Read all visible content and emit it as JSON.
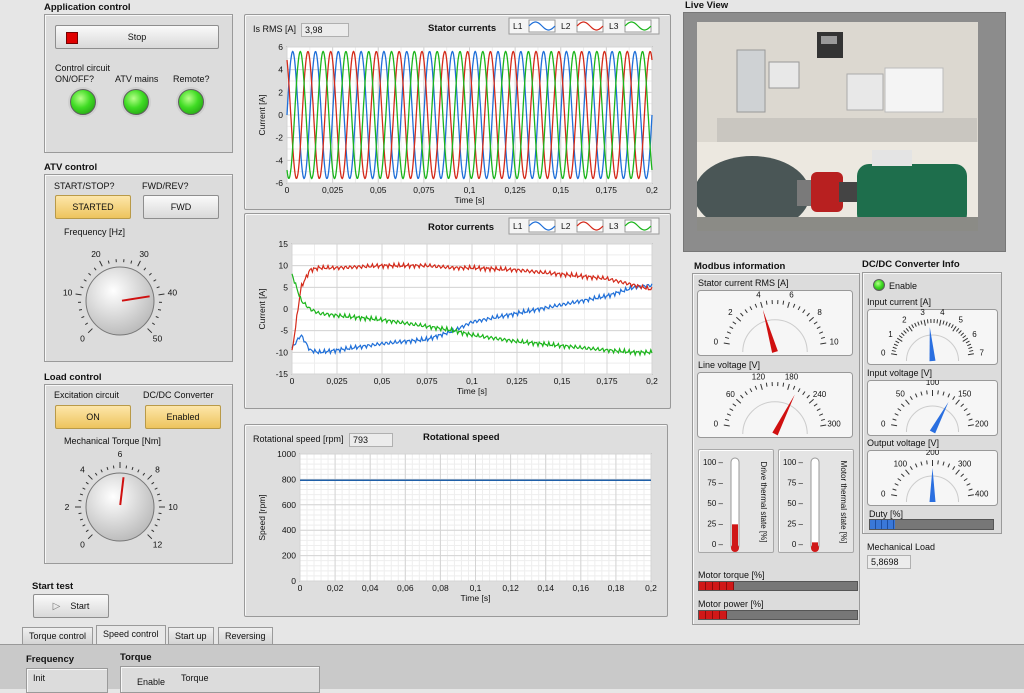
{
  "app": {
    "title": "Application control",
    "stop_label": "Stop",
    "control_circuit_label": "Control circuit\nON/OFF?",
    "atv_mains_label": "ATV mains",
    "remote_label": "Remote?"
  },
  "atv": {
    "title": "ATV control",
    "start_stop_label": "START/STOP?",
    "start_button": "STARTED",
    "fwd_rev_label": "FWD/REV?",
    "fwd_button": "FWD",
    "freq_label": "Frequency [Hz]",
    "freq_ticks": [
      "0",
      "10",
      "20",
      "30",
      "40",
      "50"
    ],
    "freq_value": 40
  },
  "load": {
    "title": "Load control",
    "excitation_label": "Excitation circuit",
    "excitation_button": "ON",
    "dcdc_label": "DC/DC Converter",
    "dcdc_button": "Enabled",
    "torque_label": "Mechanical Torque [Nm]",
    "torque_ticks": [
      "0",
      "2",
      "4",
      "6",
      "8",
      "10",
      "12"
    ],
    "torque_value": 6.3
  },
  "start_test": {
    "title": "Start test",
    "button": "Start"
  },
  "stator": {
    "title": "Stator currents",
    "rms_label": "Is RMS [A]",
    "rms_value": "3,98",
    "ylabel": "Current [A]",
    "xlabel": "Time [s]",
    "legend": [
      "L1",
      "L2",
      "L3"
    ],
    "yticks": [
      "6",
      "4",
      "2",
      "0",
      "-2",
      "-4",
      "-6"
    ],
    "xticks": [
      "0",
      "0,025",
      "0,05",
      "0,075",
      "0,1",
      "0,125",
      "0,15",
      "0,175",
      "0,2"
    ]
  },
  "rotor": {
    "title": "Rotor currents",
    "ylabel": "Current [A]",
    "xlabel": "Time [s]",
    "legend": [
      "L1",
      "L2",
      "L3"
    ],
    "yticks": [
      "15",
      "10",
      "5",
      "0",
      "-5",
      "-10",
      "-15"
    ],
    "xticks": [
      "0",
      "0,025",
      "0,05",
      "0,075",
      "0,1",
      "0,125",
      "0,15",
      "0,175",
      "0,2"
    ]
  },
  "speed": {
    "title": "Rotational speed",
    "value_label": "Rotational speed [rpm]",
    "value": "793",
    "ylabel": "Speed [rpm]",
    "xlabel": "Time [s]",
    "yticks": [
      "1000",
      "800",
      "600",
      "400",
      "200",
      "0"
    ],
    "xticks": [
      "0",
      "0,02",
      "0,04",
      "0,06",
      "0,08",
      "0,1",
      "0,12",
      "0,14",
      "0,16",
      "0,18",
      "0,2"
    ]
  },
  "chart_data": [
    {
      "type": "line",
      "title": "Stator currents",
      "xlabel": "Time [s]",
      "ylabel": "Current [A]",
      "xlim": [
        0,
        0.2
      ],
      "ylim": [
        -6,
        6
      ],
      "series": [
        {
          "name": "L1",
          "color": "#1f6fd8",
          "amplitude": 5.6,
          "frequency_hz": 80,
          "phase_deg": 0
        },
        {
          "name": "L2",
          "color": "#d42a1a",
          "amplitude": 5.6,
          "frequency_hz": 80,
          "phase_deg": 120
        },
        {
          "name": "L3",
          "color": "#1bb51b",
          "amplitude": 5.6,
          "frequency_hz": 80,
          "phase_deg": 240
        }
      ]
    },
    {
      "type": "line",
      "title": "Rotor currents",
      "xlabel": "Time [s]",
      "ylabel": "Current [A]",
      "xlim": [
        0,
        0.2
      ],
      "ylim": [
        -15,
        15
      ],
      "x": [
        0,
        0.005,
        0.01,
        0.015,
        0.025,
        0.05,
        0.075,
        0.09,
        0.1,
        0.125,
        0.15,
        0.175,
        0.19,
        0.2
      ],
      "series": [
        {
          "name": "L1",
          "color": "#1f6fd8",
          "values": [
            -9,
            -6,
            -9.5,
            -10,
            -9.5,
            -8,
            -7,
            -5,
            -3,
            -1,
            1,
            3,
            5,
            5.5
          ]
        },
        {
          "name": "L2",
          "color": "#d42a1a",
          "values": [
            -10,
            5,
            9,
            9.5,
            9.5,
            10,
            10,
            9.5,
            9.5,
            9,
            8,
            7,
            5.5,
            4.5
          ]
        },
        {
          "name": "L3",
          "color": "#1bb51b",
          "values": [
            8,
            2,
            0,
            -1,
            -1.5,
            -2.5,
            -4,
            -5,
            -6,
            -7.5,
            -8.5,
            -9.5,
            -10,
            -10
          ]
        }
      ]
    },
    {
      "type": "line",
      "title": "Rotational speed",
      "xlabel": "Time [s]",
      "ylabel": "Speed [rpm]",
      "xlim": [
        0,
        0.2
      ],
      "ylim": [
        0,
        1000
      ],
      "x": [
        0,
        0.2
      ],
      "series": [
        {
          "name": "Speed",
          "color": "#1f5fa8",
          "values": [
            793,
            793
          ]
        }
      ]
    }
  ],
  "live_view": {
    "title": "Live View"
  },
  "modbus": {
    "title": "Modbus information",
    "stator_rms_label": "Stator current RMS [A]",
    "stator_rms_ticks": [
      "0",
      "2",
      "4",
      "6",
      "8",
      "10"
    ],
    "stator_rms_value": 4,
    "line_voltage_label": "Line voltage [V]",
    "line_voltage_ticks": [
      "0",
      "60",
      "120",
      "180",
      "240",
      "300"
    ],
    "line_voltage_value": 200,
    "thermal_ticks": [
      "100",
      "75",
      "50",
      "25",
      "0"
    ],
    "drive_thermal_label": "Drive thermal state [%]",
    "drive_thermal_value": 24,
    "motor_thermal_label": "Motor thermal state [%]",
    "motor_thermal_value": 2,
    "motor_torque_label": "Motor torque [%]",
    "motor_torque_value": 0.22,
    "motor_power_label": "Motor power [%]",
    "motor_power_value": 0.18
  },
  "dcdc": {
    "title": "DC/DC Converter Info",
    "enable_label": "Enable",
    "input_current_label": "Input current [A]",
    "input_current_ticks": [
      "0",
      "1",
      "2",
      "3",
      "4",
      "5",
      "6",
      "7"
    ],
    "input_current_value": 3.3,
    "input_voltage_label": "Input voltage [V]",
    "input_voltage_ticks": [
      "0",
      "50",
      "100",
      "150",
      "200"
    ],
    "input_voltage_value": 135,
    "output_voltage_label": "Output voltage [V]",
    "output_voltage_ticks": [
      "0",
      "100",
      "200",
      "300",
      "400"
    ],
    "output_voltage_value": 200,
    "duty_label": "Duty [%]",
    "duty_value": 0.2,
    "mech_load_label": "Mechanical Load",
    "mech_load_value": "5,8698"
  },
  "tabs": [
    "Torque control",
    "Speed control",
    "Start up",
    "Reversing"
  ],
  "bottom": {
    "frequency_label": "Frequency",
    "init_label": "Init",
    "torque_label": "Torque",
    "enable_label": "Enable",
    "torque_sub_label": "Torque"
  },
  "colors": {
    "l1": "#1f6fd8",
    "l2": "#d42a1a",
    "l3": "#1bb51b",
    "led_green": "#3fdc23",
    "needle_red": "#d01010",
    "needle_blue": "#2a6fe0",
    "bar_red": "#d01818",
    "bar_blue": "#3a78d8"
  }
}
